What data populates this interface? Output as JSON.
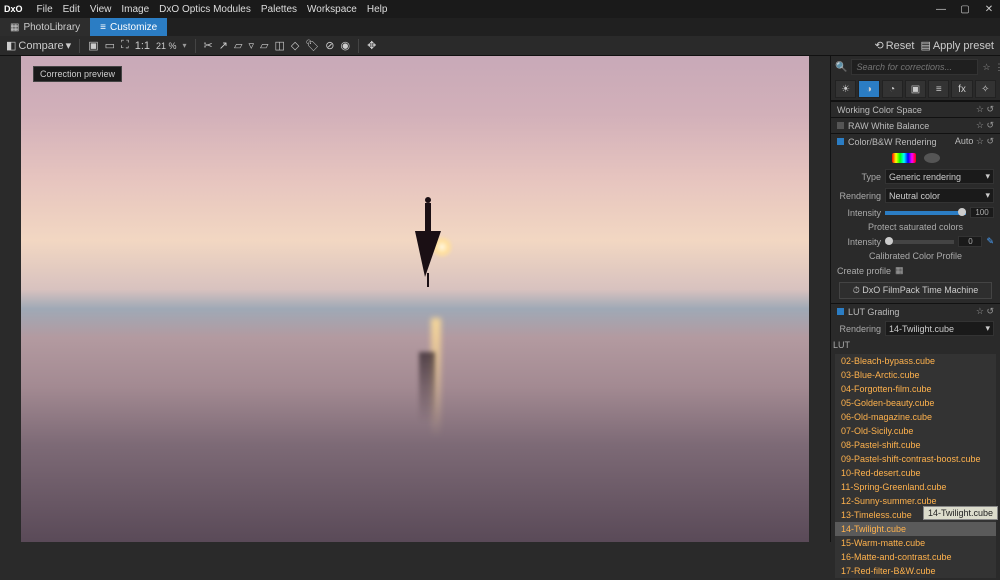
{
  "menu": {
    "logo": "DxO",
    "items": [
      "File",
      "Edit",
      "View",
      "Image",
      "DxO Optics Modules",
      "Palettes",
      "Workspace",
      "Help"
    ]
  },
  "tabs": {
    "library": "PhotoLibrary",
    "customize": "Customize"
  },
  "toolbar": {
    "compare": "Compare",
    "ratio_label": "1:1",
    "zoom": "21 %",
    "reset": "Reset",
    "apply_preset": "Apply preset"
  },
  "canvas": {
    "badge": "Correction preview"
  },
  "search": {
    "placeholder": "Search for corrections..."
  },
  "panels": {
    "wcs": "Working Color Space",
    "rawwb": "RAW White Balance",
    "color_render": {
      "title": "Color/B&W Rendering",
      "auto": "Auto",
      "type_label": "Type",
      "type_value": "Generic rendering",
      "rendering_label": "Rendering",
      "rendering_value": "Neutral color",
      "intensity_label": "Intensity",
      "intensity_value": "100",
      "protect": "Protect saturated colors",
      "intensity2_label": "Intensity",
      "intensity2_value": "0",
      "ccp": "Calibrated Color Profile",
      "create_profile": "Create profile",
      "time_machine": "DxO FilmPack Time Machine"
    },
    "lut": {
      "title": "LUT Grading",
      "rendering_label": "Rendering",
      "rendering_value": "14-Twilight.cube",
      "folder_label": "LUT",
      "items": [
        "02-Bleach-bypass.cube",
        "03-Blue-Arctic.cube",
        "04-Forgotten-film.cube",
        "05-Golden-beauty.cube",
        "06-Old-magazine.cube",
        "07-Old-Sicily.cube",
        "08-Pastel-shift.cube",
        "09-Pastel-shift-contrast-boost.cube",
        "10-Red-desert.cube",
        "11-Spring-Greenland.cube",
        "12-Sunny-summer.cube",
        "13-Timeless.cube",
        "14-Twilight.cube",
        "15-Warm-matte.cube",
        "16-Matte-and-contrast.cube",
        "17-Red-filter-B&W.cube"
      ],
      "selected_index": 12,
      "tooltip": "14-Twilight.cube"
    }
  }
}
